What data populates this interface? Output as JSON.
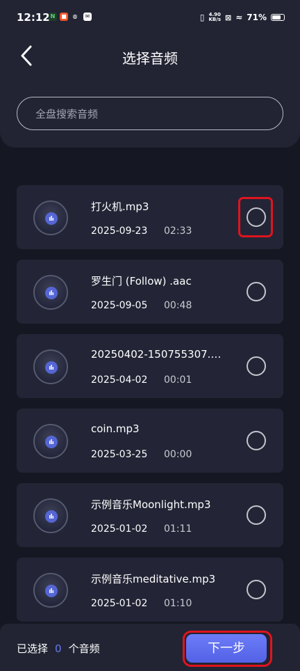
{
  "status_bar": {
    "time": "12:12",
    "net_speed_value": "4.90",
    "net_speed_unit": "KB/s",
    "battery": "71%",
    "notification_icons": [
      "n-app-icon",
      "orange-app-icon",
      "weibo-icon",
      "message-icon"
    ]
  },
  "header": {
    "title": "选择音频",
    "search_placeholder": "全盘搜索音频"
  },
  "files": [
    {
      "name": "打火机.mp3",
      "date": "2025-09-23",
      "duration": "02:33"
    },
    {
      "name": "罗生门 (Follow) .aac",
      "date": "2025-09-05",
      "duration": "00:48"
    },
    {
      "name": "20250402-150755307.…",
      "date": "2025-04-02",
      "duration": "00:01"
    },
    {
      "name": "coin.mp3",
      "date": "2025-03-25",
      "duration": "00:00"
    },
    {
      "name": "示例音乐Moonlight.mp3",
      "date": "2025-01-02",
      "duration": "01:11"
    },
    {
      "name": "示例音乐meditative.mp3",
      "date": "2025-01-02",
      "duration": "01:10"
    }
  ],
  "footer": {
    "selected_prefix": "已选择",
    "selected_count": "0",
    "selected_suffix": "个音频",
    "next_label": "下一步"
  },
  "colors": {
    "accent": "#5b6cf0",
    "highlight": "#e0141e",
    "background": "#151722",
    "card": "#232536"
  }
}
